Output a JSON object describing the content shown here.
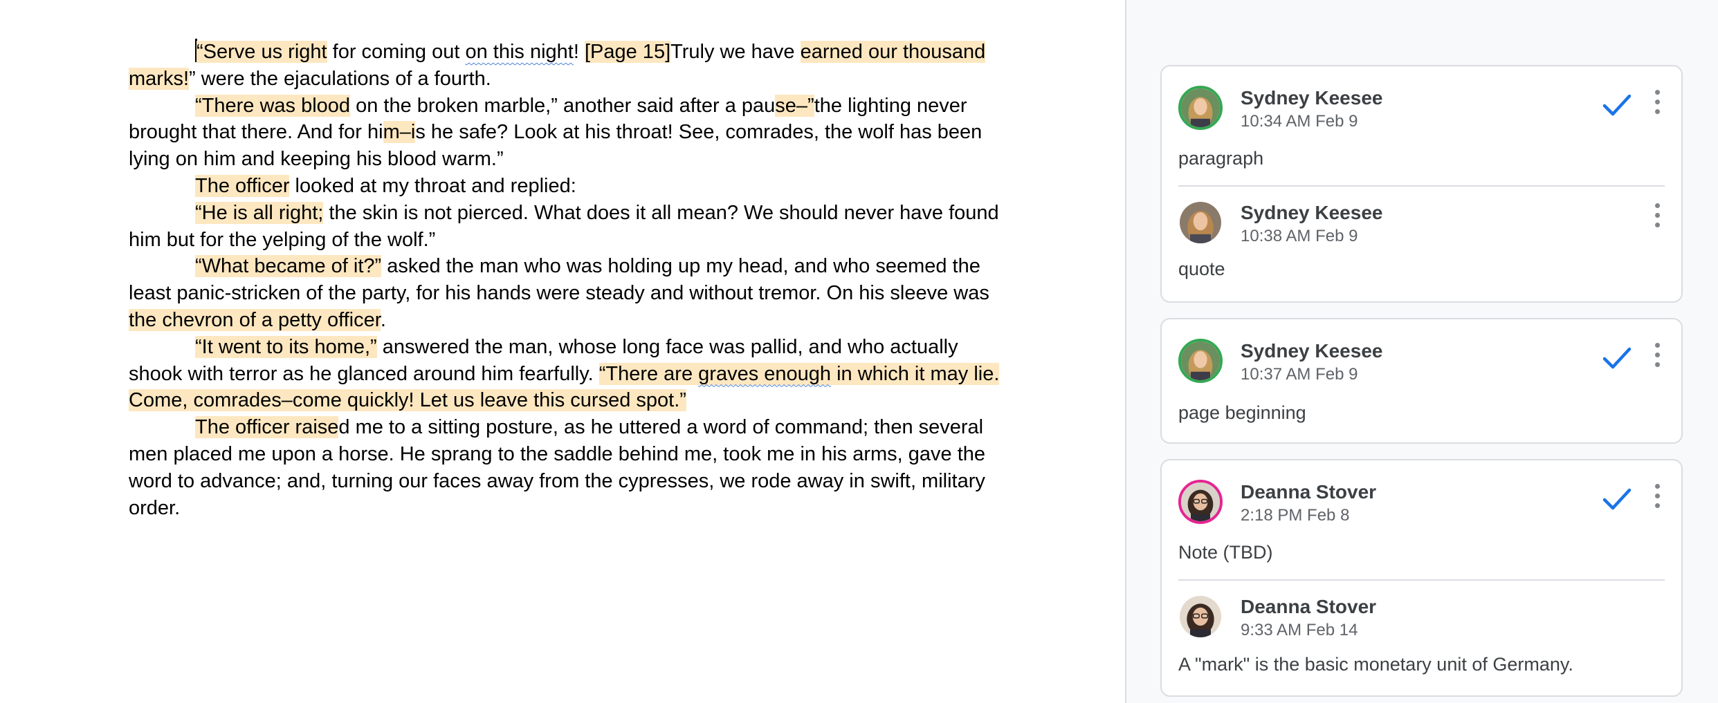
{
  "document": {
    "paragraphs": [
      [
        {
          "t": "“Serve us right",
          "hl": true,
          "cursor": true
        },
        {
          "t": " for coming out "
        },
        {
          "t": "on this night",
          "sq": true
        },
        {
          "t": "! "
        },
        {
          "t": "[Page 15]",
          "hl": true
        },
        {
          "t": "Truly we have "
        },
        {
          "t": "earned our thousand marks!",
          "hl": true
        },
        {
          "t": "” were the ejaculations of a fourth."
        }
      ],
      [
        {
          "t": "“There was blood",
          "hl": true
        },
        {
          "t": " on the broken marble,” another said after a pau"
        },
        {
          "t": "se–”",
          "hl": true
        },
        {
          "t": "the lighting never brought that there. And for hi"
        },
        {
          "t": "m–i",
          "hl": true
        },
        {
          "t": "s he safe? Look at his throat! See, comrades, the wolf has been lying on him and keeping his blood warm.”"
        }
      ],
      [
        {
          "t": "The officer",
          "hl": true
        },
        {
          "t": " looked at my throat and replied:"
        }
      ],
      [
        {
          "t": "“He is all right;",
          "hl": true
        },
        {
          "t": " the skin is not pierced. What does it all mean? We should never have found him but for the yelping of the wolf.”"
        }
      ],
      [
        {
          "t": "“What became of it?”",
          "hl": true
        },
        {
          "t": " asked the man who was holding up my head, and who seemed the least panic-stricken of the party, for his hands were steady and without tremor. On his sleeve was "
        },
        {
          "t": "the chevron of a petty officer",
          "hl": true
        },
        {
          "t": "."
        }
      ],
      [
        {
          "t": "“It went to its home,”",
          "hl": true
        },
        {
          "t": " answered the man, whose long face was pallid, and who actually shook with terror as he glanced around him fearfully. "
        },
        {
          "t": "“There are ",
          "hl": true
        },
        {
          "t": "graves enough",
          "hl": true,
          "sq": true
        },
        {
          "t": " in which it may lie. Come, comrades–come quickly! Let us leave this cursed spot.”",
          "hl": true
        }
      ],
      [
        {
          "t": "The officer raise",
          "hl": true
        },
        {
          "t": "d me to a sitting posture, as he uttered a word of command; then several men placed me upon a horse. He sprang to the saddle behind me, took me in his arms, gave the word to advance; and, turning our faces away from the cypresses, we rode away in swift, military order."
        }
      ]
    ]
  },
  "comments": [
    {
      "resolve_icon": "check-icon",
      "menu_icon": "more-vert-icon",
      "entries": [
        {
          "author": "Sydney Keesee",
          "time": "10:34 AM Feb 9",
          "text": "paragraph"
        },
        {
          "author": "Sydney Keesee",
          "time": "10:38 AM Feb 9",
          "text": "quote"
        }
      ]
    },
    {
      "resolve_icon": "check-icon",
      "menu_icon": "more-vert-icon",
      "entries": [
        {
          "author": "Sydney Keesee",
          "time": "10:37 AM Feb 9",
          "text": "page beginning"
        }
      ]
    },
    {
      "resolve_icon": "check-icon",
      "menu_icon": "more-vert-icon",
      "entries": [
        {
          "author": "Deanna Stover",
          "time": "2:18 PM Feb 8",
          "text": "Note (TBD)"
        },
        {
          "author": "Deanna Stover",
          "time": "9:33 AM Feb 14",
          "text": "A \"mark\" is the basic monetary unit of Germany."
        }
      ]
    }
  ],
  "colors": {
    "highlight": "#fde7c0",
    "accent_blue": "#1a73e8",
    "ring_green": "#34a853",
    "ring_pink": "#e52592"
  }
}
